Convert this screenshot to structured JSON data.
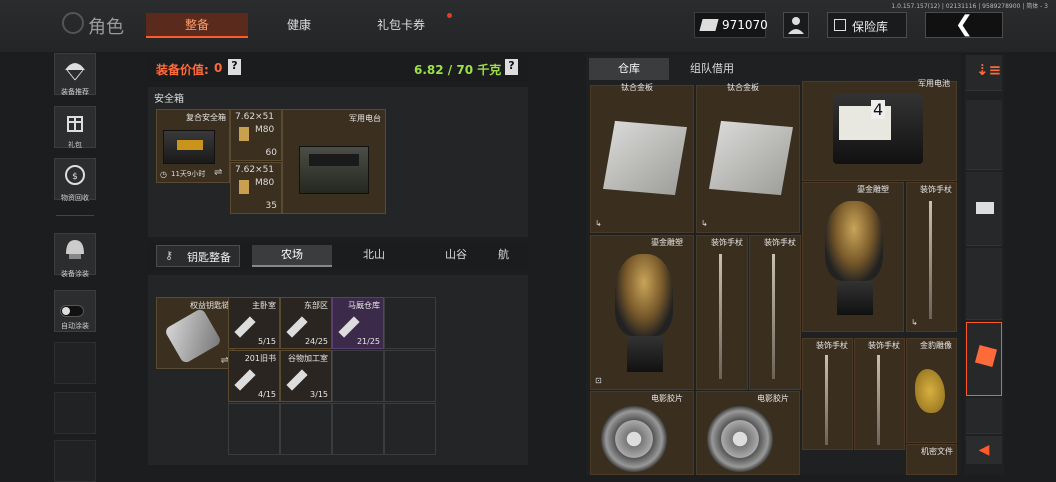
{
  "header": {
    "title": "角色",
    "version": "1.0.157.157(12) | 02131116 | 9589278900 | 简体 - 3",
    "tabs": [
      {
        "label": "整备",
        "active": true
      },
      {
        "label": "健康",
        "active": false
      },
      {
        "label": "礼包卡券",
        "active": false,
        "badge": true
      }
    ],
    "money": "971070",
    "vault_label": "保险库",
    "back_label": "❮"
  },
  "sidebar": {
    "items": [
      {
        "label": "装备推荐",
        "icon": "parachute-icon"
      },
      {
        "label": "礼包",
        "icon": "gift-icon"
      },
      {
        "label": "物资回收",
        "icon": "recycle-icon"
      },
      {
        "label": "装备涂装",
        "icon": "helmet-icon"
      },
      {
        "label": "自动涂装",
        "icon": "toggle-icon"
      }
    ]
  },
  "equipment": {
    "value_label": "装备价值: ",
    "value": "0",
    "weight": "6.82 / 70 千克",
    "help": "?",
    "safe_box_title": "安全箱",
    "safe_box_name": "复合安全箱",
    "safe_box_timer": "11天9小时",
    "ammo": [
      {
        "caliber": "7.62×51",
        "type": "M80",
        "count": "60"
      },
      {
        "caliber": "7.62×51",
        "type": "M80",
        "count": "35"
      }
    ],
    "radio_label": "军用电台",
    "swap": "⇌"
  },
  "keys": {
    "button_label": "钥匙整备",
    "maps": [
      {
        "label": "农场",
        "active": true
      },
      {
        "label": "北山",
        "active": false
      },
      {
        "label": "山谷",
        "active": false
      },
      {
        "label": "航",
        "active": false
      }
    ],
    "keychain_label": "权益钥匙链",
    "items": [
      {
        "label": "主卧室",
        "count": "5/15"
      },
      {
        "label": "东部区",
        "count": "24/25"
      },
      {
        "label": "马厩仓库",
        "count": "21/25"
      },
      {
        "label": "201旧书",
        "count": "4/15"
      },
      {
        "label": "谷物加工室",
        "count": "3/15"
      }
    ]
  },
  "storage": {
    "tabs": [
      {
        "label": "仓库",
        "active": true
      },
      {
        "label": "组队借用",
        "active": false
      }
    ],
    "items": [
      {
        "label": "钛合金板"
      },
      {
        "label": "钛合金板"
      },
      {
        "label": "军用电池"
      },
      {
        "label": "鎏金雕塑"
      },
      {
        "label": "装饰手杖"
      },
      {
        "label": "鎏金雕塑"
      },
      {
        "label": "装饰手杖"
      },
      {
        "label": "装饰手杖"
      },
      {
        "label": "装饰手杖"
      },
      {
        "label": "装饰手杖"
      },
      {
        "label": "金豹雕像"
      },
      {
        "label": "电影胶片"
      },
      {
        "label": "电影胶片"
      },
      {
        "label": "机密文件"
      }
    ],
    "battery_number": "4"
  }
}
